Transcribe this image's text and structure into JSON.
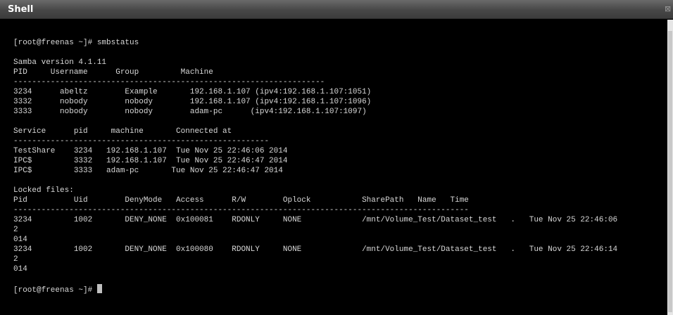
{
  "window": {
    "title": "Shell",
    "close_glyph": "⊠"
  },
  "terminal": {
    "lines": [
      "[root@freenas ~]# smbstatus",
      "",
      "Samba version 4.1.11",
      "PID     Username      Group         Machine",
      "-------------------------------------------------------------------",
      "3234      abeltz        Example       192.168.1.107 (ipv4:192.168.1.107:1051)",
      "3332      nobody        nobody        192.168.1.107 (ipv4:192.168.1.107:1096)",
      "3333      nobody        nobody        adam-pc      (ipv4:192.168.1.107:1097)",
      "",
      "Service      pid     machine       Connected at",
      "-------------------------------------------------------",
      "TestShare    3234   192.168.1.107  Tue Nov 25 22:46:06 2014",
      "IPC$         3332   192.168.1.107  Tue Nov 25 22:46:47 2014",
      "IPC$         3333   adam-pc       Tue Nov 25 22:46:47 2014",
      "",
      "Locked files:",
      "Pid          Uid        DenyMode   Access      R/W        Oplock           SharePath   Name   Time",
      "--------------------------------------------------------------------------------------------------",
      "3234         1002       DENY_NONE  0x100081    RDONLY     NONE             /mnt/Volume_Test/Dataset_test   .   Tue Nov 25 22:46:06",
      "2",
      "014",
      "3234         1002       DENY_NONE  0x100080    RDONLY     NONE             /mnt/Volume_Test/Dataset_test   .   Tue Nov 25 22:46:14",
      "2",
      "014",
      "",
      "[root@freenas ~]# "
    ]
  }
}
